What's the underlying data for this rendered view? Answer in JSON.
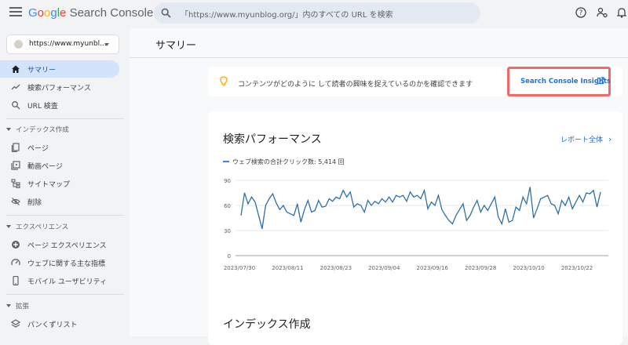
{
  "header": {
    "logo_google": "Google",
    "logo_product": "Search Console",
    "search_text": "「https://www.myunblog.org/」内のすべての URL を検索"
  },
  "sidebar": {
    "property": "https://www.myunbl...",
    "items_top": [
      {
        "label": "サマリー",
        "icon": "home-icon",
        "active": true
      },
      {
        "label": "検索パフォーマンス",
        "icon": "trending-icon"
      },
      {
        "label": "URL 検査",
        "icon": "search-icon"
      }
    ],
    "section_index": "インデックス作成",
    "items_index": [
      {
        "label": "ページ",
        "icon": "pages-icon"
      },
      {
        "label": "動画ページ",
        "icon": "video-icon"
      },
      {
        "label": "サイトマップ",
        "icon": "sitemap-icon"
      },
      {
        "label": "削除",
        "icon": "removal-icon"
      }
    ],
    "section_experience": "エクスペリエンス",
    "items_experience": [
      {
        "label": "ページ エクスペリエンス",
        "icon": "experience-icon"
      },
      {
        "label": "ウェブに関する主な指標",
        "icon": "vitals-icon"
      },
      {
        "label": "モバイル ユーザビリティ",
        "icon": "mobile-icon"
      }
    ],
    "section_extensions": "拡張",
    "items_extensions": [
      {
        "label": "パンくずリスト",
        "icon": "layers-icon"
      }
    ]
  },
  "main": {
    "page_title": "サマリー",
    "insight_text": "コンテンツがどのように して読者の興味を捉えているのかを確認できます",
    "insight_link": "Search Console Insights",
    "perf_title": "検索パフォーマンス",
    "report_link": "レポート全体",
    "legend": "ウェブ検索の合計クリック数: 5,414 回",
    "index_title": "インデックス作成"
  },
  "colors": {
    "accent": "#1a73e8",
    "line": "#2f6fa8",
    "highlight": "#f06a6a"
  },
  "chart_data": {
    "type": "line",
    "yticks": [
      "90",
      "60",
      "30",
      "0"
    ],
    "ylim": [
      0,
      90
    ],
    "xticks": [
      "2023/07/30",
      "2023/08/11",
      "2023/08/23",
      "2023/09/04",
      "2023/09/16",
      "2023/09/28",
      "2023/10/10",
      "2023/10/22"
    ],
    "series": [
      {
        "name": "ウェブ検索の合計クリック数: 5,414 回",
        "values": [
          48,
          75,
          62,
          70,
          64,
          48,
          32,
          60,
          68,
          74,
          63,
          55,
          60,
          52,
          50,
          48,
          62,
          40,
          55,
          66,
          52,
          54,
          66,
          58,
          59,
          68,
          65,
          70,
          68,
          78,
          70,
          76,
          58,
          62,
          60,
          52,
          66,
          60,
          65,
          62,
          68,
          64,
          70,
          64,
          72,
          70,
          72,
          65,
          76,
          70,
          72,
          68,
          78,
          56,
          64,
          60,
          72,
          55,
          48,
          42,
          38,
          48,
          55,
          62,
          42,
          48,
          58,
          66,
          52,
          60,
          54,
          62,
          70,
          46,
          38,
          56,
          40,
          42,
          58,
          54,
          70,
          62,
          82,
          45,
          56,
          68,
          70,
          72,
          62,
          60,
          50,
          66,
          60,
          70,
          56,
          64,
          72,
          64,
          75,
          74,
          78,
          58,
          76
        ]
      }
    ]
  }
}
